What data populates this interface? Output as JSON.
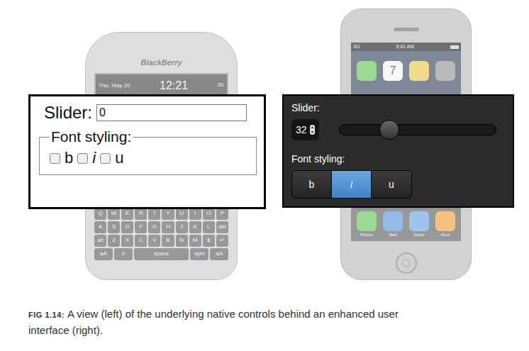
{
  "native_phone": {
    "brand": "BlackBerry",
    "date": "Thu, May 20",
    "time": "12:21",
    "network": "3G",
    "keys": [
      [
        "Q",
        "W",
        "E",
        "R",
        "T",
        "Y",
        "U",
        "I",
        "O",
        "P"
      ],
      [
        "A",
        "S",
        "D",
        "F",
        "G",
        "H",
        "J",
        "K",
        "L",
        "del"
      ],
      [
        "alt",
        "Z",
        "X",
        "C",
        "V",
        "B",
        "N",
        "M",
        "$",
        "↵"
      ],
      [
        "aA",
        "0",
        "space",
        "sym",
        "aA"
      ]
    ]
  },
  "native_form": {
    "slider_label": "Slider:",
    "slider_value": "0",
    "fieldset_legend": "Font styling:",
    "options": [
      {
        "label": "b",
        "checked": false,
        "italic": false
      },
      {
        "label": "i",
        "checked": false,
        "italic": true
      },
      {
        "label": "u",
        "checked": false,
        "italic": false
      }
    ]
  },
  "enhanced_phone": {
    "status_time": "9:41 AM",
    "network": "3G",
    "apps": [
      {
        "label": "",
        "color": "#5cc14e"
      },
      {
        "label": "7",
        "color": "#f4f4f4"
      },
      {
        "label": "",
        "color": "#e9c23a"
      },
      {
        "label": "",
        "color": "#8c8c8c"
      }
    ],
    "dock": [
      {
        "label": "Phone",
        "color": "#5cc14e"
      },
      {
        "label": "Mail",
        "color": "#4d8fd6"
      },
      {
        "label": "Safari",
        "color": "#5aa0e0"
      },
      {
        "label": "iPod",
        "color": "#f09a2a"
      }
    ]
  },
  "enhanced_form": {
    "slider_label": "Slider:",
    "slider_value": "32",
    "level": 0.32,
    "fieldset_legend": "Font styling:",
    "options": [
      {
        "label": "b",
        "selected": false,
        "italic": false
      },
      {
        "label": "i",
        "selected": true,
        "italic": true
      },
      {
        "label": "u",
        "selected": false,
        "italic": false
      }
    ]
  },
  "figure": {
    "caption_label": "FIG 1.14:",
    "caption": "A view (left) of the underlying native controls behind an enhanced user interface (right)."
  }
}
